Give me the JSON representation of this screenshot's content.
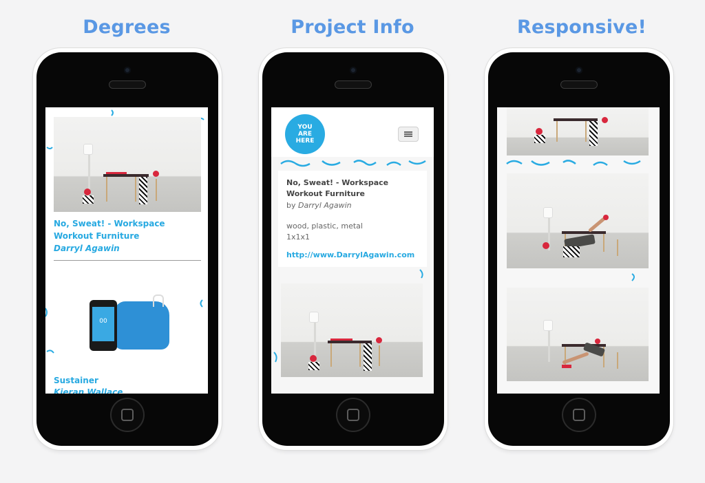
{
  "headings": {
    "degrees": "Degrees",
    "project_info": "Project Info",
    "responsive": "Responsive!"
  },
  "phone1": {
    "project1_title": "No, Sweat! - Workspace Workout Furniture",
    "project1_author": "Darryl Agawin",
    "project2_title": "Sustainer",
    "project2_author": "Kieran Wallace",
    "phone_screen_label": "00"
  },
  "phone2": {
    "logo_text": "YOU ARE HERE",
    "project_title": "No, Sweat! - Workspace Workout Furniture",
    "by_label": "by",
    "author": "Darryl Agawin",
    "materials": "wood, plastic, metal",
    "dimensions": "1x1x1",
    "website": "http://www.DarrylAgawin.com"
  },
  "colors": {
    "heading": "#5a98e4",
    "accent": "#27a9e1",
    "logo_bg": "#29abe2"
  },
  "icons": [
    "menu-icon",
    "home-button-icon"
  ]
}
